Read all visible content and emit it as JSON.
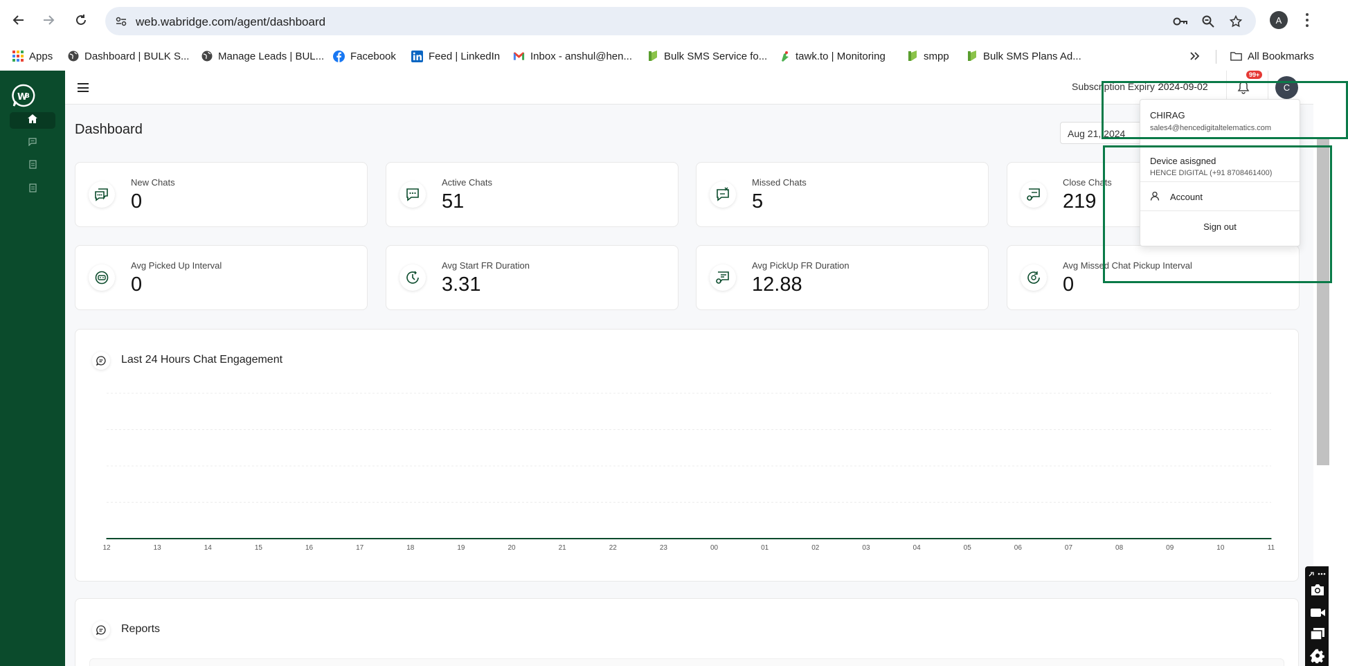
{
  "browser": {
    "url": "web.wabridge.com/agent/dashboard",
    "profile_initial": "A",
    "bookmarks": [
      {
        "label": "Apps",
        "icon": "apps-grid-icon"
      },
      {
        "label": "Dashboard | BULK S...",
        "icon": "globe-icon"
      },
      {
        "label": "Manage Leads | BUL...",
        "icon": "globe-icon"
      },
      {
        "label": "Facebook",
        "icon": "facebook-icon"
      },
      {
        "label": "Feed | LinkedIn",
        "icon": "linkedin-icon"
      },
      {
        "label": "Inbox - anshul@hen...",
        "icon": "gmail-icon"
      },
      {
        "label": "Bulk SMS Service fo...",
        "icon": "bulk-sms-icon"
      },
      {
        "label": "tawk.to | Monitoring",
        "icon": "tawk-icon"
      },
      {
        "label": "smpp",
        "icon": "bulk-sms-icon"
      },
      {
        "label": "Bulk SMS Plans Ad...",
        "icon": "bulk-sms-icon"
      }
    ],
    "all_bookmarks_label": "All Bookmarks"
  },
  "header": {
    "subscription_label": "Subscription Expiry :",
    "subscription_date": "2024-09-02",
    "notification_badge": "99+",
    "avatar_initial": "C"
  },
  "dashboard": {
    "title": "Dashboard",
    "date": "Aug 21, 2024",
    "stats": [
      {
        "label": "New Chats",
        "value": "0",
        "icon": "new-chats-icon"
      },
      {
        "label": "Active Chats",
        "value": "51",
        "icon": "active-chats-icon"
      },
      {
        "label": "Missed Chats",
        "value": "5",
        "icon": "missed-chats-icon"
      },
      {
        "label": "Close Chats",
        "value": "219",
        "icon": "close-chats-icon"
      },
      {
        "label": "Avg Picked Up Interval",
        "value": "0",
        "icon": "avg-picked-icon"
      },
      {
        "label": "Avg Start FR Duration",
        "value": "3.31",
        "icon": "avg-start-icon"
      },
      {
        "label": "Avg PickUp FR Duration",
        "value": "12.88",
        "icon": "avg-pickup-icon"
      },
      {
        "label": "Avg Missed Chat Pickup Interval",
        "value": "0",
        "icon": "avg-missed-icon"
      }
    ],
    "engagement_title": "Last 24 Hours Chat Engagement",
    "reports_title": "Reports"
  },
  "chart_data": {
    "type": "line",
    "title": "Last 24 Hours Chat Engagement",
    "categories": [
      "12",
      "13",
      "14",
      "15",
      "16",
      "17",
      "18",
      "19",
      "20",
      "21",
      "22",
      "23",
      "00",
      "01",
      "02",
      "03",
      "04",
      "05",
      "06",
      "07",
      "08",
      "09",
      "10",
      "11"
    ],
    "series": [
      {
        "values": [
          0,
          0,
          0,
          0,
          0,
          0,
          0,
          0,
          0,
          0,
          0,
          0,
          0,
          0,
          0,
          0,
          0,
          0,
          0,
          0,
          0,
          0,
          0,
          0
        ]
      }
    ],
    "grid": true
  },
  "user_menu": {
    "name": "CHIRAG",
    "email": "sales4@hencedigitaltelematics.com",
    "device_label": "Device asisgned",
    "device_value": "HENCE DIGITAL (+91 8708461400)",
    "account_label": "Account",
    "signout_label": "Sign out"
  },
  "colors": {
    "sidebar": "#0b4b2c",
    "accent": "#0a7a48",
    "badge": "#e53935"
  }
}
